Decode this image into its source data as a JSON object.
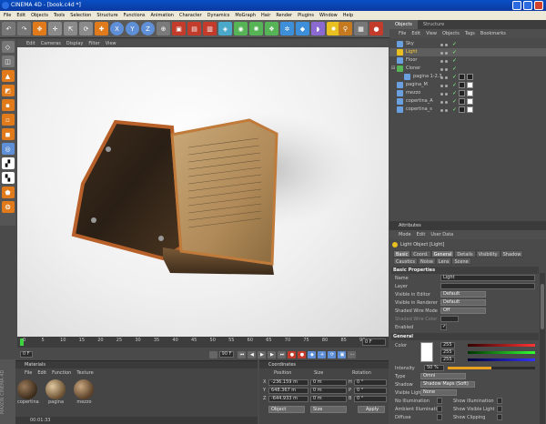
{
  "title": "CINEMA 4D - [book.c4d *]",
  "menu": [
    "File",
    "Edit",
    "Objects",
    "Tools",
    "Selection",
    "Structure",
    "Functions",
    "Animation",
    "Character",
    "Dynamics",
    "MoGraph",
    "Hair",
    "Render",
    "Plugins",
    "Window",
    "Help"
  ],
  "toolbar": {
    "axis_x": "X",
    "axis_y": "Y",
    "axis_z": "Z"
  },
  "viewport": {
    "menu": [
      "Edit",
      "Cameras",
      "Display",
      "Filter",
      "View"
    ]
  },
  "timeline": {
    "ticks": [
      "0",
      "5",
      "10",
      "15",
      "20",
      "25",
      "30",
      "35",
      "40",
      "45",
      "50",
      "55",
      "60",
      "65",
      "70",
      "75",
      "80",
      "85",
      "90"
    ],
    "frame_value": "0 F"
  },
  "playback": {
    "start_field": "0 F",
    "end_field": "90 F"
  },
  "materials": {
    "header": "Materials",
    "menu": [
      "File",
      "Edit",
      "Function",
      "Texture"
    ],
    "items": [
      {
        "label": "copertina"
      },
      {
        "label": "pagina"
      },
      {
        "label": "mezzo"
      }
    ]
  },
  "status": {
    "time": "00:01:33"
  },
  "coordinates": {
    "header": "Coordinates",
    "col_position": "Position",
    "col_size": "Size",
    "col_rotation": "Rotation",
    "rows": [
      {
        "axis": "X",
        "pos": "-236.159 m",
        "size": "0 m",
        "rot_label": "H",
        "rot": "0 °"
      },
      {
        "axis": "Y",
        "pos": "648.367 m",
        "size": "0 m",
        "rot_label": "P",
        "rot": "0 °"
      },
      {
        "axis": "Z",
        "pos": "-644.933 m",
        "size": "0 m",
        "rot_label": "B",
        "rot": "0 °"
      }
    ],
    "mode_select": "Object",
    "size_select": "Size",
    "apply": "Apply"
  },
  "objects": {
    "tabs": [
      "Objects",
      "Structure"
    ],
    "menu": [
      "File",
      "Edit",
      "View",
      "Objects",
      "Tags",
      "Bookmarks"
    ],
    "items": [
      {
        "name": "Sky",
        "indent": 0
      },
      {
        "name": "Light",
        "indent": 0
      },
      {
        "name": "Floor",
        "indent": 0
      },
      {
        "name": "Cloner",
        "indent": 0
      },
      {
        "name": "pagina 1-2.3",
        "indent": 1
      },
      {
        "name": "pagina_M",
        "indent": 0
      },
      {
        "name": "mezzo",
        "indent": 0
      },
      {
        "name": "copertina_A",
        "indent": 0
      },
      {
        "name": "copertina_s",
        "indent": 0
      }
    ]
  },
  "attributes": {
    "header": "Attributes",
    "menu": [
      "Mode",
      "Edit",
      "User Data"
    ],
    "title": "Light Object [Light]",
    "tabs": [
      "Basic",
      "Coord.",
      "General",
      "Details",
      "Visibility",
      "Shadow",
      "Caustics",
      "Noise",
      "Lens",
      "Scene"
    ],
    "basic_section": "Basic Properties",
    "rows": [
      {
        "label": "Name",
        "value": "Light"
      },
      {
        "label": "Layer",
        "value": ""
      },
      {
        "label": "Visible in Editor",
        "value": "Default"
      },
      {
        "label": "Visible in Renderer",
        "value": "Default"
      },
      {
        "label": "Shaded Wire Mode",
        "value": "Off"
      },
      {
        "label": "Shaded Wire Color",
        "value": ""
      },
      {
        "label": "Enabled",
        "value": "✓"
      }
    ],
    "general_section": "General",
    "color_label": "Color",
    "rgb": [
      "255",
      "255",
      "255"
    ],
    "intensity_label": "Intensity",
    "intensity_value": "50 %",
    "intensity_fraction": 0.5,
    "type_label": "Type",
    "type_value": "Omni",
    "shadow_label": "Shadow",
    "shadow_value": "Shadow Maps (Soft)",
    "visible_light_label": "Visible Light",
    "visible_light_value": "None",
    "checks_left": [
      "No Illumination",
      "Ambient Illumination",
      "Diffuse"
    ],
    "checks_right": [
      "Show Illumination",
      "Show Visible Light",
      "Show Clipping"
    ]
  },
  "left_label": "MAXON CINEMA 4D"
}
